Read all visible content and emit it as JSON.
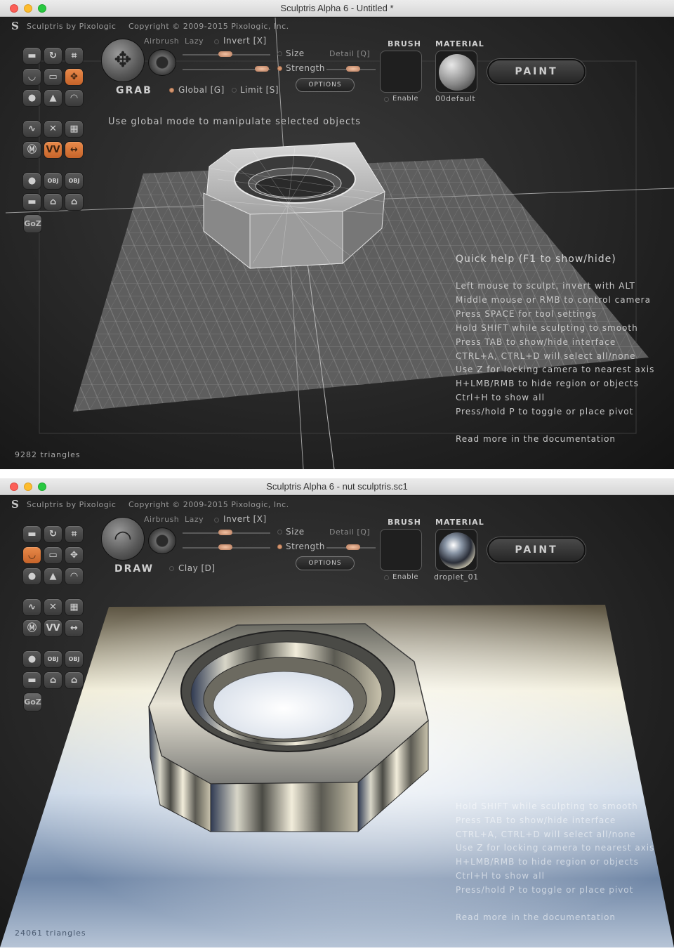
{
  "window1": {
    "title": "Sculptris Alpha 6 - Untitled *",
    "app_label": "Sculptris by Pixologic",
    "copyright": "Copyright © 2009-2015 Pixologic, Inc.",
    "tool_name": "GRAB",
    "airbrush_label": "Airbrush",
    "lazy_label": "Lazy",
    "invert_label": "Invert [X]",
    "size_label": "Size",
    "detail_label": "Detail [Q]",
    "strength_label": "Strength",
    "options_label": "OPTIONS",
    "global_label": "Global [G]",
    "limit_label": "Limit [S]",
    "brush_label": "BRUSH",
    "enable_label": "Enable",
    "material_label": "MATERIAL",
    "material_name": "00default",
    "paint_label": "PAINT",
    "hint": "Use global mode to manipulate selected objects",
    "quick_help": {
      "title": "Quick help (F1 to show/hide)",
      "lines": [
        "Left mouse to sculpt, invert with ALT",
        "Middle mouse or RMB to control camera",
        "Press SPACE for tool settings",
        "Hold SHIFT while sculpting to smooth",
        "Press TAB to show/hide interface",
        "CTRL+A, CTRL+D will select all/none",
        "Use Z for locking camera to nearest axis",
        "H+LMB/RMB to hide region or objects",
        "Ctrl+H to show all",
        "Press/hold P to toggle or place pivot"
      ],
      "docs": "Read more in the documentation"
    },
    "triangles": "9282 triangles",
    "goz_label": "GoZ"
  },
  "window2": {
    "title": "Sculptris Alpha 6 - nut sculptris.sc1",
    "app_label": "Sculptris by Pixologic",
    "copyright": "Copyright © 2009-2015 Pixologic, Inc.",
    "tool_name": "DRAW",
    "airbrush_label": "Airbrush",
    "lazy_label": "Lazy",
    "invert_label": "Invert [X]",
    "size_label": "Size",
    "detail_label": "Detail [Q]",
    "strength_label": "Strength",
    "options_label": "OPTIONS",
    "clay_label": "Clay [D]",
    "brush_label": "BRUSH",
    "enable_label": "Enable",
    "material_label": "MATERIAL",
    "material_name": "droplet_01",
    "paint_label": "PAINT",
    "quick_help": {
      "lines": [
        "Hold SHIFT while sculpting to smooth",
        "Press TAB to show/hide interface",
        "CTRL+A, CTRL+D will select all/none",
        "Use Z for locking camera to nearest axis",
        "H+LMB/RMB to hide region or objects",
        "Ctrl+H to show all",
        "Press/hold P to toggle or place pivot"
      ],
      "docs": "Read more in the documentation"
    },
    "triangles": "24061 triangles",
    "goz_label": "GoZ"
  },
  "colors": {
    "accent": "#d87a3c",
    "slider_knob": "#e8b396",
    "viewport_bg": "#262626"
  }
}
